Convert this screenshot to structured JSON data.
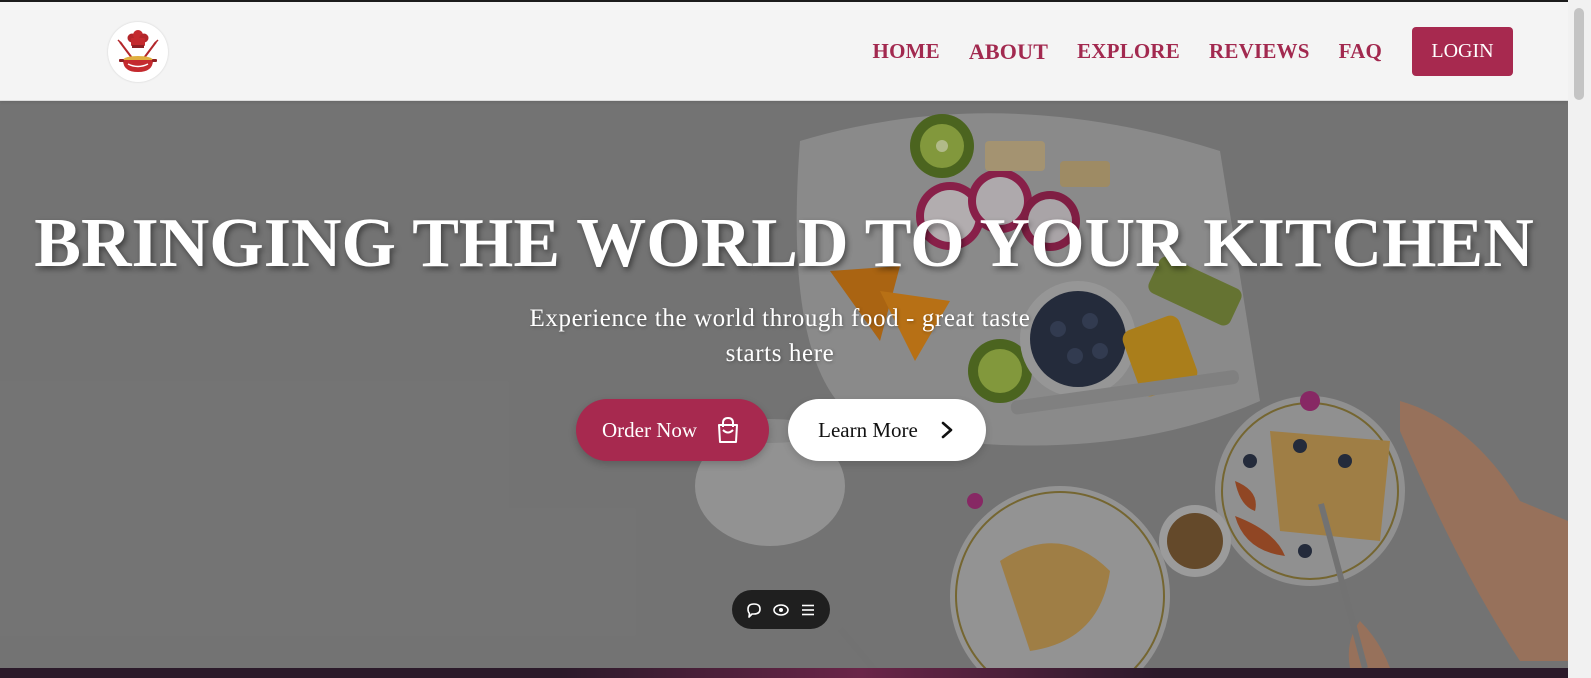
{
  "brand": {
    "logo_icon": "chef-pot-icon",
    "accent_color": "#a7294f"
  },
  "nav": {
    "links": [
      {
        "label": "HOME"
      },
      {
        "label": "ABOUT"
      },
      {
        "label": "EXPLORE"
      },
      {
        "label": "REVIEWS"
      },
      {
        "label": "FAQ"
      }
    ],
    "login_label": "LOGIN"
  },
  "hero": {
    "title": "BRINGING THE WORLD TO YOUR KITCHEN",
    "subtitle": "Experience the world through food - great taste starts here",
    "order_button": {
      "label": "Order Now",
      "icon": "shopping-bag-icon"
    },
    "learn_button": {
      "label": "Learn More",
      "icon": "chevron-right-icon"
    }
  },
  "toolbar": {
    "icons": [
      "chat-bubble-icon",
      "eye-icon",
      "menu-icon"
    ]
  }
}
